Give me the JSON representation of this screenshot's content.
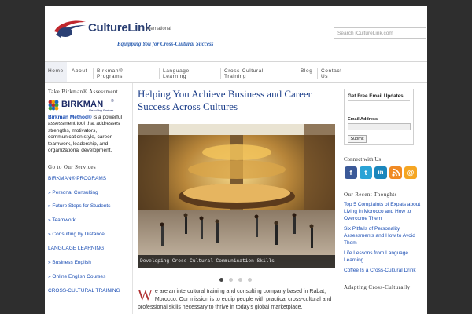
{
  "header": {
    "logo_culture": "Culture",
    "logo_link": "Link",
    "logo_international": "international",
    "tagline": "Equipping You for Cross-Cultural Success",
    "search_placeholder": "Search iCultureLink.com",
    "brand_colors": {
      "navy": "#2a3f73",
      "red": "#c0272d",
      "blue": "#2a5db0"
    }
  },
  "nav": {
    "items": [
      {
        "label": "Home",
        "active": true
      },
      {
        "label": "About"
      },
      {
        "label": "Birkman® Programs"
      },
      {
        "label": "Language Learning"
      },
      {
        "label": "Cross-Cultural Training"
      },
      {
        "label": "Blog"
      },
      {
        "label": "Contact Us"
      }
    ]
  },
  "left": {
    "assessment_heading": "Take Birkman® Assessment",
    "birkman_word": "BIRKMAN",
    "birkman_reg": "®",
    "birkman_partner": "Reaching Partner",
    "birkman_method": "Birkman Method®",
    "birkman_desc": " is a powerful assessment tool that addresses strengths, motivators, communication style, career, teamwork, leadership, and organizational development.",
    "services_heading": "Go to Our Services",
    "services": [
      "BIRKMAN® PROGRAMS",
      "» Personal Consulting",
      "» Future Steps for Students",
      "» Teamwork",
      "» Consulting by Distance",
      "LANGUAGE LEARNING",
      "» Business English",
      "» Online English Courses",
      "CROSS-CULTURAL TRAINING"
    ]
  },
  "main": {
    "headline": "Helping You Achieve Business and Career Success Across Cultures",
    "hero_caption": "Developing Cross-Cultural Communication Skills",
    "slide_count": 4,
    "active_slide": 1,
    "intro_dropcap": "W",
    "intro_text": "e are an intercultural training and consulting company based in Rabat, Morocco. Our mission is to equip people with practical cross-cultural and professional skills necessary to thrive in today's global marketplace."
  },
  "right": {
    "email_title": "Get Free Email Updates",
    "email_label": "Email Address",
    "submit_label": "Submit",
    "connect_heading": "Connect with Us",
    "social_icons": [
      "facebook-icon",
      "twitter-icon",
      "linkedin-icon",
      "rss-icon",
      "email-icon"
    ],
    "thoughts_heading": "Our Recent Thoughts",
    "thoughts": [
      "Top 5 Complaints of Expats about Living in Morocco and How to Overcome Them",
      "Six Pitfalls of Personality Assessments and How to Avoid Them",
      "Life Lessons from Language Learning",
      "Coffee Is a Cross-Cultural Drink"
    ],
    "adapting_heading": "Adapting Cross-Culturally"
  }
}
